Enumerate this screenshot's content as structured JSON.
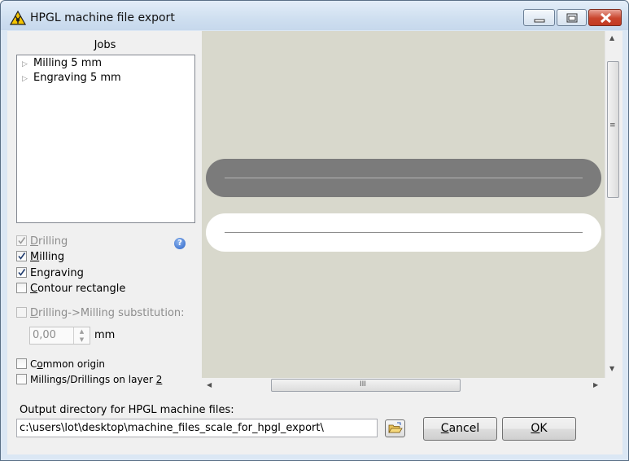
{
  "window": {
    "title": "HPGL machine file export"
  },
  "jobs": {
    "label": "Jobs",
    "items": [
      {
        "label": "Milling 5 mm",
        "icon": "tree-expander-icon"
      },
      {
        "label": "Engraving 5 mm",
        "icon": "tree-expander-icon"
      }
    ]
  },
  "options": {
    "drilling": {
      "pre": "",
      "key": "D",
      "post": "rilling",
      "checked": true,
      "enabled": false
    },
    "milling": {
      "pre": "",
      "key": "M",
      "post": "illing",
      "checked": true,
      "enabled": true
    },
    "engraving": {
      "pre": "En",
      "key": "g",
      "post": "raving",
      "checked": true,
      "enabled": true
    },
    "contour_rectangle": {
      "pre": "",
      "key": "C",
      "post": "ontour rectangle",
      "checked": false,
      "enabled": true
    },
    "substitution": {
      "pre": "",
      "key": "D",
      "post": "rilling->Milling substitution:",
      "checked": false,
      "enabled": false
    },
    "substitution_value": "0,00",
    "substitution_unit": "mm",
    "common_origin": {
      "pre": "C",
      "key": "o",
      "post": "mmon origin",
      "checked": false,
      "enabled": true
    },
    "layer2": {
      "pre": "Millings/Drillings on layer ",
      "key": "2",
      "post": "",
      "checked": false,
      "enabled": true
    }
  },
  "help_icon": "help-icon",
  "output": {
    "label": "Output directory for HPGL machine files:",
    "path": "c:\\users\\lot\\desktop\\machine_files_scale_for_hpgl_export\\"
  },
  "buttons": {
    "cancel": {
      "pre": "",
      "key": "C",
      "post": "ancel"
    },
    "ok": {
      "pre": "",
      "key": "O",
      "post": "K"
    }
  },
  "colors": {
    "preview_background": "#d8d8cc",
    "milling_track": "#7b7b7b",
    "engraving_track": "#ffffff"
  }
}
